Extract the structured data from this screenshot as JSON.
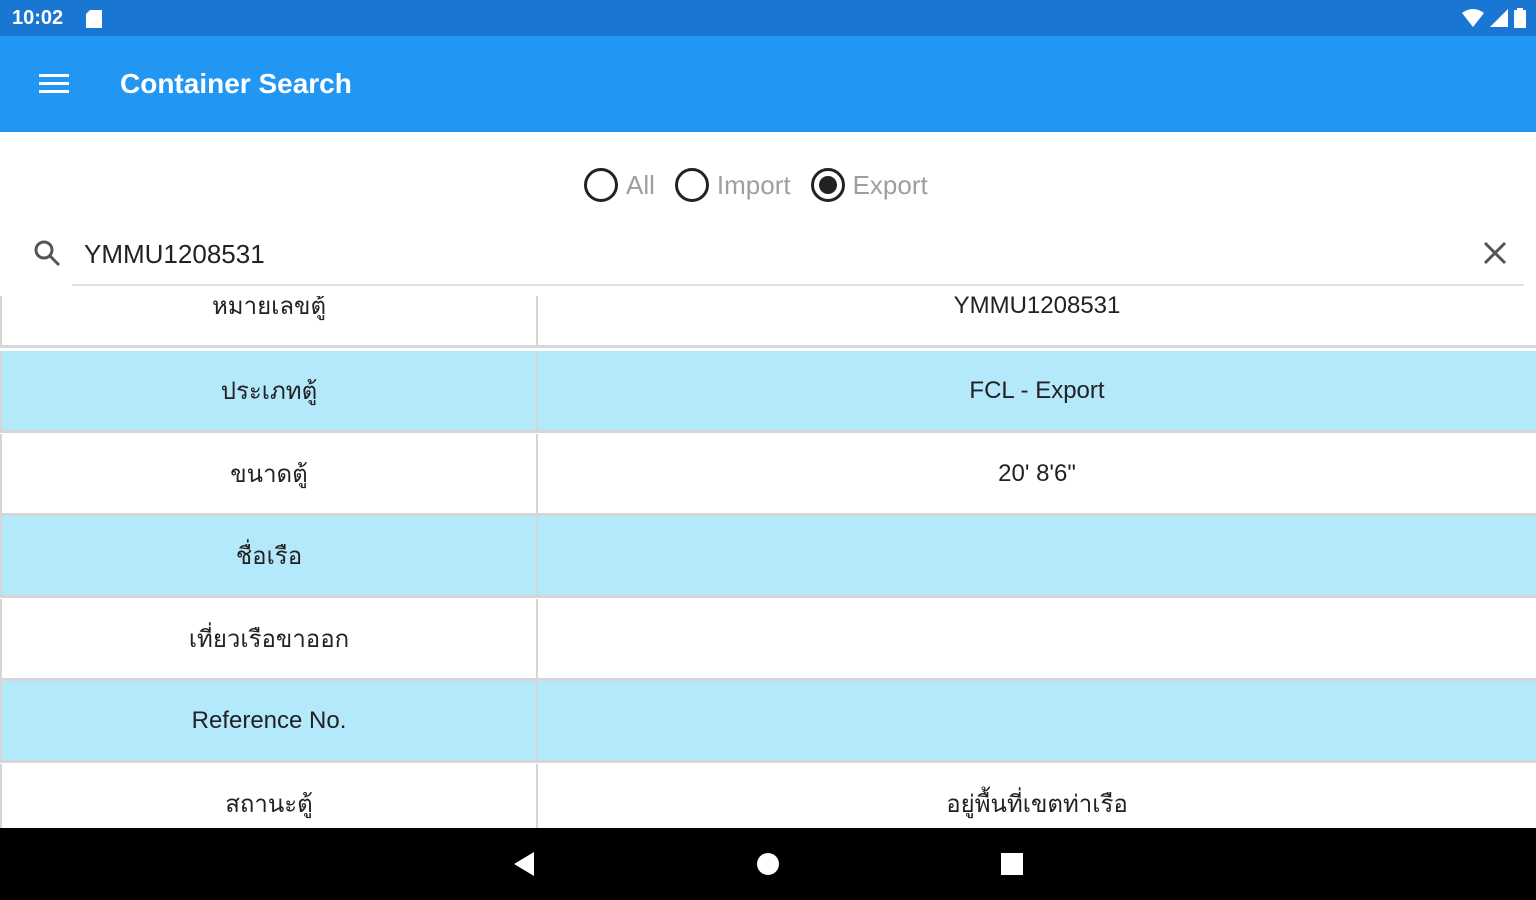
{
  "status_bar": {
    "time": "10:02"
  },
  "app_bar": {
    "title": "Container Search"
  },
  "filter": {
    "options": [
      {
        "label": "All",
        "checked": false
      },
      {
        "label": "Import",
        "checked": false
      },
      {
        "label": "Export",
        "checked": true
      }
    ]
  },
  "search": {
    "value": "YMMU1208531"
  },
  "table": {
    "rows": [
      {
        "key": "หมายเลขตู้",
        "value": "YMMU1208531"
      },
      {
        "key": "ประเภทตู้",
        "value": "FCL - Export"
      },
      {
        "key": "ขนาดตู้",
        "value": "20' 8'6\""
      },
      {
        "key": "ชื่อเรือ",
        "value": ""
      },
      {
        "key": "เที่ยวเรือขาออก",
        "value": ""
      },
      {
        "key": "Reference No.",
        "value": ""
      },
      {
        "key": "สถานะตู้",
        "value": "อยู่พื้นที่เขตท่าเรือ"
      }
    ]
  },
  "colors": {
    "status_bar": "#1976d2",
    "app_bar": "#2196f3",
    "row_alt": "#b3e9fb"
  }
}
